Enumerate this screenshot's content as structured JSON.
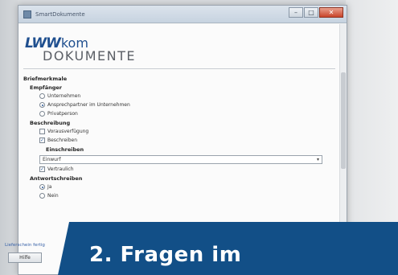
{
  "window": {
    "title": "SmartDokumente",
    "minimize": "–",
    "maximize": "□",
    "close": "✕"
  },
  "logo": {
    "brand": "LWW",
    "brand_suffix": "kom",
    "product": "DOKUMENTE"
  },
  "form": {
    "section_title": "Briefmerkmale",
    "recipient": {
      "label": "Empfänger",
      "options": [
        "Unternehmen",
        "Ansprechpartner im Unternehmen",
        "Privatperson"
      ],
      "selected_index": 1
    },
    "notes": {
      "label": "Beschreibung",
      "options": [
        {
          "label": "Vorausverfügung",
          "checked": false
        },
        {
          "label": "Beschreiben",
          "checked": true
        }
      ],
      "sub_label": "Einschreiben",
      "select_value": "Einwurf",
      "extra": {
        "label": "Vertraulich",
        "checked": true
      }
    },
    "reply": {
      "label": "Antwortschreiben",
      "options": [
        "Ja",
        "Nein"
      ],
      "selected_index": 0
    }
  },
  "footer": {
    "link_text": "Lieferschein fertig",
    "help_button": "Hilfe"
  },
  "banner": {
    "text": "2. Fragen im"
  },
  "colors": {
    "brand_blue": "#1f4f8f",
    "banner_blue": "#124f87"
  }
}
